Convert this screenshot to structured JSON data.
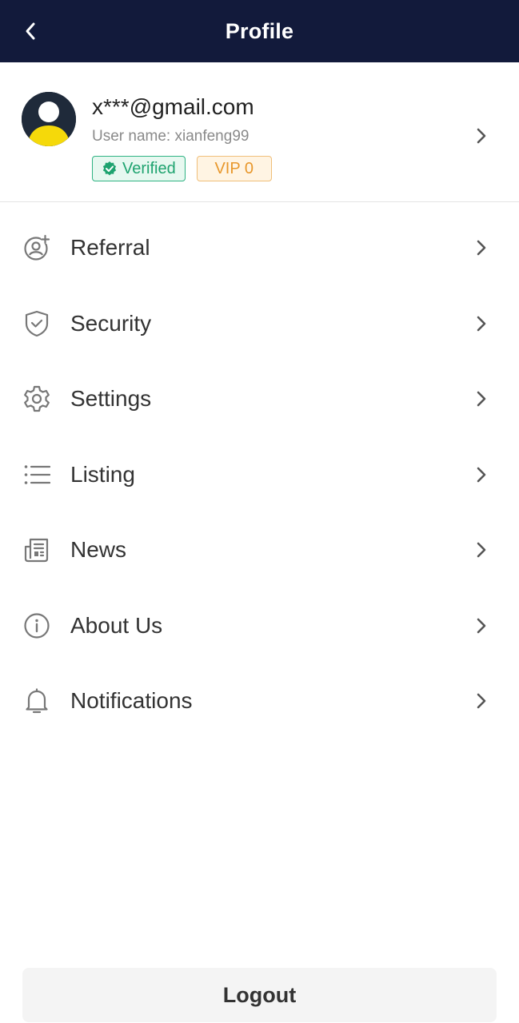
{
  "header": {
    "title": "Profile",
    "back_icon": "chevron-left-icon",
    "background": "#121a3b"
  },
  "profile": {
    "email": "x***@gmail.com",
    "username_label": "User name:",
    "username": "xianfeng99",
    "verified_label": "Verified",
    "vip_label": "VIP 0",
    "avatar_icon": "user-avatar-icon"
  },
  "menu": {
    "items": [
      {
        "label": "Referral",
        "icon": "user-plus-icon"
      },
      {
        "label": "Security",
        "icon": "shield-check-icon"
      },
      {
        "label": "Settings",
        "icon": "gear-icon"
      },
      {
        "label": "Listing",
        "icon": "list-icon"
      },
      {
        "label": "News",
        "icon": "newspaper-icon"
      },
      {
        "label": "About Us",
        "icon": "info-icon"
      },
      {
        "label": "Notifications",
        "icon": "bell-icon"
      }
    ]
  },
  "footer": {
    "logout_label": "Logout"
  },
  "colors": {
    "verified": "#1ea36f",
    "vip": "#e8972b",
    "avatar_accent": "#f5d90a"
  }
}
